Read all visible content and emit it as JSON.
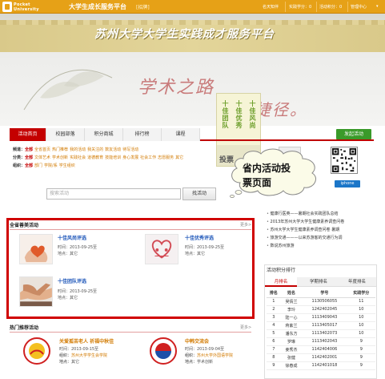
{
  "topbar": {
    "logo_line1": "Pocket",
    "logo_line2": "University",
    "title": "大学生成长服务平台",
    "tag": "[招牌]",
    "links": [
      "名天知伴",
      "实践学分：0",
      "活动积分：0",
      "管理中心"
    ]
  },
  "banner": {
    "title": "苏州大学大学生实践成才服务平台",
    "slogan1": "学术之路",
    "slogan2": "有捷径。"
  },
  "poster": {
    "col1": "十佳团队",
    "col2": "十佳优秀",
    "col3": "十佳风尚",
    "vote": "投票"
  },
  "nav": {
    "tabs": [
      "活动首页",
      "校园部落",
      "积分商城",
      "排行榜",
      "课程"
    ],
    "start_button": "发起活动"
  },
  "filters": [
    {
      "label": "频道：",
      "all": "全部",
      "options": [
        "全省首页",
        "热门推荐",
        "我的活动",
        "我关注的",
        "数友活动",
        "待写活动"
      ]
    },
    {
      "label": "分类：",
      "all": "全部",
      "options": [
        "文体艺术",
        "学术创新",
        "实践社会",
        "道德教育",
        "技能培训",
        "身心发展",
        "社会工作",
        "志愿服务",
        "其它"
      ]
    },
    {
      "label": "组织：",
      "all": "全部",
      "options": [
        "部门",
        "学院/系",
        "学生组织"
      ]
    }
  ],
  "search": {
    "placeholder": "搜索活动",
    "button": "找活动"
  },
  "qr": {
    "label": "iphone"
  },
  "callout": {
    "line1": "省内活动投",
    "line2": "票页面"
  },
  "section_province": {
    "title": "全省善美活动",
    "more": "更多>",
    "cards": [
      {
        "title": "十佳风尚评选",
        "time": "时间：2013-09-25至",
        "location": "地点：其它"
      },
      {
        "title": "十佳优秀评选",
        "time": "时间：2013-09-25至",
        "location": "地点：其它"
      },
      {
        "title": "十佳团队评选",
        "time": "时间：2013-09-25至",
        "location": "地点：其它"
      }
    ]
  },
  "section_hot": {
    "title": "热门推荐活动",
    "more": "更多>",
    "items": [
      {
        "title": "关爱孤苦老人 祈福中秋佳",
        "time": "时间：2013-09-15至",
        "org": "组织：",
        "org_val": "苏州大学学生会学院",
        "place": "地点：",
        "place_val": "其它"
      },
      {
        "title": "中韩交流会",
        "time": "时间：2013-09-04至",
        "org": "组织：",
        "org_val": "苏州大学外国语学院",
        "place": "地点：",
        "place_val": "学术创新"
      }
    ]
  },
  "news": [
    "健康行医英——暑期社会实践团队总结",
    "2013年苏州大学大学生健康素养调查问卷",
    "苏州大学大学生健康素养调查问卷 暑期",
    "旅游交通———以来苏游客的交通行为调",
    "数说苏州旅游"
  ],
  "ranking": {
    "title": "活动积分排行",
    "tabs": [
      "月排名",
      "学期排名",
      "年度排名"
    ],
    "headers": [
      "排名",
      "姓名",
      "学号",
      "实践学分"
    ],
    "rows": [
      [
        "1",
        "吴倩兰",
        "1130506055",
        "11"
      ],
      [
        "2",
        "李玲",
        "1242402045",
        "10"
      ],
      [
        "3",
        "陆一心",
        "1113409043",
        "10"
      ],
      [
        "4",
        "蒋紫兰",
        "1113405017",
        "10"
      ],
      [
        "5",
        "潘东方",
        "1113402073",
        "10"
      ],
      [
        "6",
        "罗琳",
        "1113402043",
        "9"
      ],
      [
        "7",
        "姜秀杰",
        "1142404006",
        "9"
      ],
      [
        "8",
        "张健",
        "1142402001",
        "9"
      ],
      [
        "9",
        "徐春成",
        "1142401018",
        "9"
      ]
    ]
  },
  "colors": {
    "topbar": "#e6a117",
    "accent_red": "#c40000",
    "highlight_box": "#d00000",
    "link_blue": "#1b54b8",
    "link_orange": "#d27a00",
    "start_green": "#3a9a2a"
  }
}
